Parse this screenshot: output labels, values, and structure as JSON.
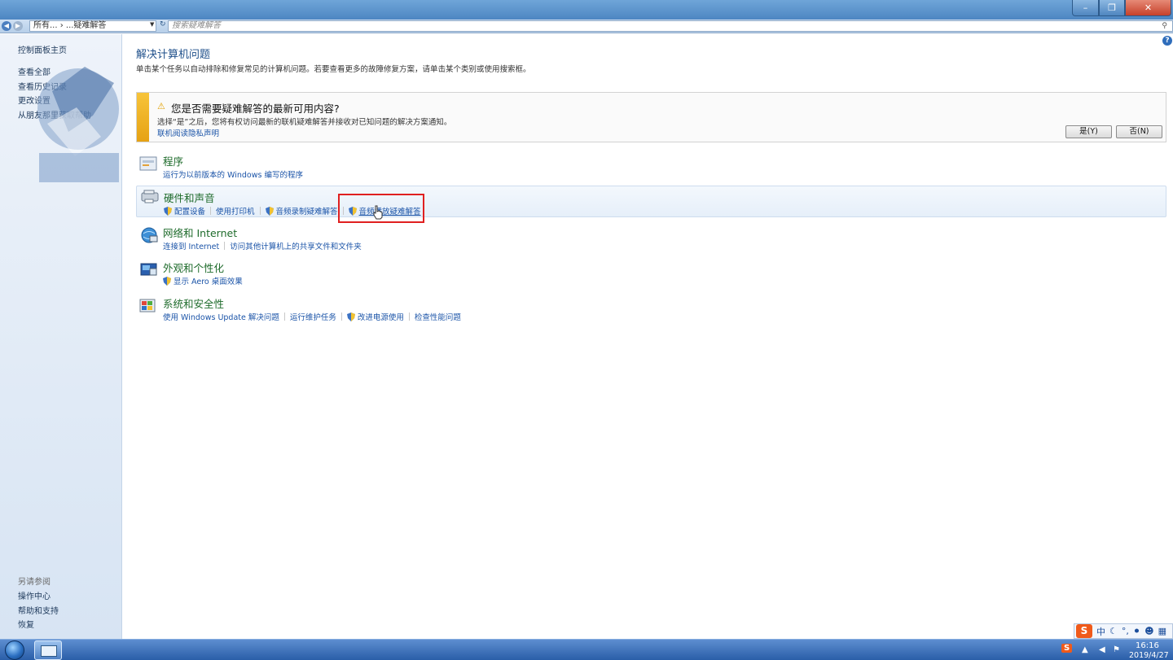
{
  "window": {
    "minimize_icon": "minimize-icon",
    "maximize_icon": "restore-icon",
    "close_icon": "close-icon"
  },
  "address": {
    "path": "所有... › ...疑难解答",
    "search_placeholder": "搜索疑难解答"
  },
  "sidebar": {
    "links": [
      "控制面板主页",
      "查看全部",
      "查看历史记录",
      "更改设置",
      "从朋友那里获取帮助"
    ],
    "see_also_label": "另请参阅",
    "see_also": [
      "操作中心",
      "帮助和支持",
      "恢复"
    ]
  },
  "main": {
    "title": "解决计算机问题",
    "description": "单击某个任务以自动排除和修复常见的计算机问题。若要查看更多的故障修复方案，请单击某个类别或使用搜索框。",
    "notice": {
      "title": "您是否需要疑难解答的最新可用内容?",
      "text": "选择“是”之后，您将有权访问最新的联机疑难解答并接收对已知问题的解决方案通知。",
      "link": "联机阅读隐私声明",
      "yes": "是(Y)",
      "no": "否(N)"
    },
    "categories": [
      {
        "title": "程序",
        "icon": "programs-icon",
        "links": [
          {
            "label": "运行为以前版本的 Windows 编写的程序",
            "shield": false
          }
        ]
      },
      {
        "title": "硬件和声音",
        "icon": "hardware-sound-icon",
        "links": [
          {
            "label": "配置设备",
            "shield": true
          },
          {
            "label": "使用打印机",
            "shield": false
          },
          {
            "label": "音频录制疑难解答",
            "shield": true
          },
          {
            "label": "音频播放疑难解答",
            "shield": true
          }
        ]
      },
      {
        "title": "网络和 Internet",
        "icon": "network-icon",
        "links": [
          {
            "label": "连接到 Internet",
            "shield": false
          },
          {
            "label": "访问其他计算机上的共享文件和文件夹",
            "shield": false
          }
        ]
      },
      {
        "title": "外观和个性化",
        "icon": "appearance-icon",
        "links": [
          {
            "label": "显示 Aero 桌面效果",
            "shield": true
          }
        ]
      },
      {
        "title": "系统和安全性",
        "icon": "system-security-icon",
        "links": [
          {
            "label": "使用 Windows Update 解决问题",
            "shield": false
          },
          {
            "label": "运行维护任务",
            "shield": false
          },
          {
            "label": "改进电源使用",
            "shield": true
          },
          {
            "label": "检查性能问题",
            "shield": false
          }
        ]
      }
    ]
  },
  "taskbar": {
    "ime_brand": "S",
    "ime_lang": "中",
    "time": "16:16",
    "date": "2019/4/27"
  }
}
